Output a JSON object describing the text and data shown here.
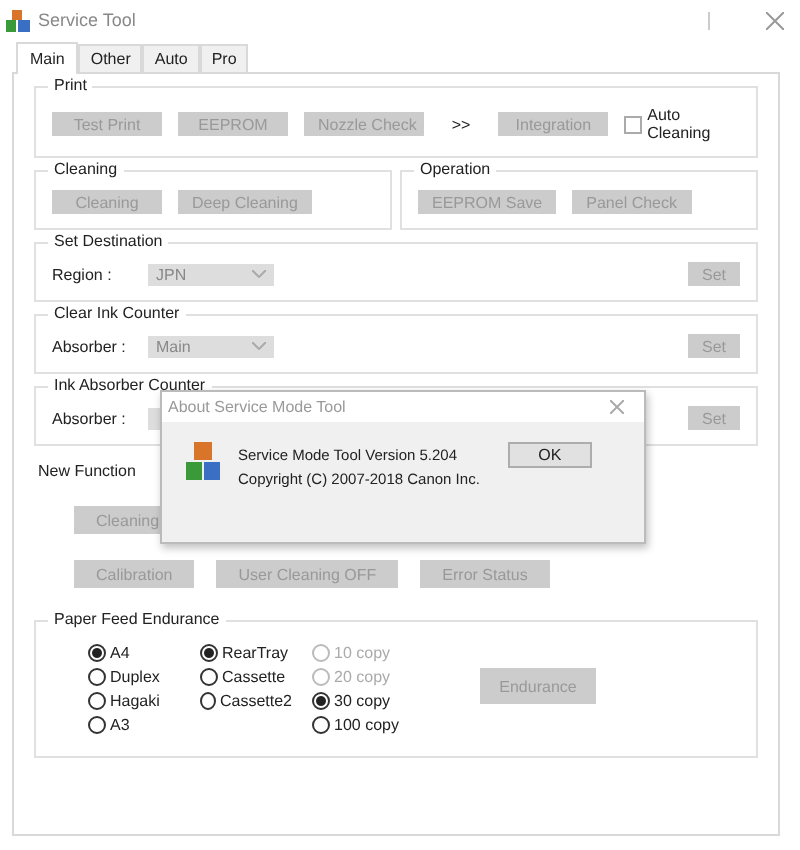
{
  "window": {
    "title": "Service Tool"
  },
  "tabs": [
    {
      "label": "Main",
      "selected": true
    },
    {
      "label": "Other",
      "selected": false
    },
    {
      "label": "Auto",
      "selected": false
    },
    {
      "label": "Pro",
      "selected": false
    }
  ],
  "print": {
    "title": "Print",
    "buttons": [
      {
        "label": "Test Print",
        "disabled": true
      },
      {
        "label": "EEPROM",
        "disabled": true
      },
      {
        "label": "Nozzle Check",
        "disabled": true
      }
    ],
    "arrow": ">>",
    "integration": {
      "label": "Integration",
      "disabled": true
    },
    "auto_cleaning": {
      "label": "Auto Cleaning",
      "checked": false
    }
  },
  "cleaning": {
    "title": "Cleaning",
    "buttons": [
      {
        "label": "Cleaning",
        "disabled": true
      },
      {
        "label": "Deep Cleaning",
        "disabled": true
      }
    ]
  },
  "operation": {
    "title": "Operation",
    "buttons": [
      {
        "label": "EEPROM Save",
        "disabled": true
      },
      {
        "label": "Panel Check",
        "disabled": true
      }
    ]
  },
  "settings": [
    {
      "title": "Set Destination",
      "label": "Region :",
      "value": "JPN",
      "button": {
        "label": "Set",
        "disabled": true
      }
    },
    {
      "title": "Clear Ink Counter",
      "label": "Absorber :",
      "value": "Main",
      "button": {
        "label": "Set",
        "disabled": true
      }
    },
    {
      "title": "Ink Absorber Counter",
      "label": "Absorber :",
      "button": {
        "label": "Set",
        "disabled": true
      }
    }
  ],
  "new_function": {
    "title": "New Function",
    "rows": [
      [
        {
          "label": "Cleaning",
          "disabled": true
        }
      ],
      [
        {
          "label": "Calibration",
          "disabled": true
        },
        {
          "label": "User Cleaning OFF",
          "disabled": true
        },
        {
          "label": "Error Status",
          "disabled": true
        }
      ]
    ]
  },
  "paper_feed": {
    "title": "Paper Feed Endurance",
    "columns": [
      [
        {
          "label": "A4",
          "selected": true,
          "disabled": false
        },
        {
          "label": "Duplex",
          "selected": false,
          "disabled": false
        },
        {
          "label": "Hagaki",
          "selected": false,
          "disabled": false
        },
        {
          "label": "A3",
          "selected": false,
          "disabled": false
        }
      ],
      [
        {
          "label": "RearTray",
          "selected": true,
          "disabled": false
        },
        {
          "label": "Cassette",
          "selected": false,
          "disabled": false
        },
        {
          "label": "Cassette2",
          "selected": false,
          "disabled": false
        }
      ],
      [
        {
          "label": "10 copy",
          "selected": false,
          "disabled": true
        },
        {
          "label": "20 copy",
          "selected": false,
          "disabled": true
        },
        {
          "label": "30 copy",
          "selected": true,
          "disabled": false
        },
        {
          "label": "100 copy",
          "selected": false,
          "disabled": false
        }
      ]
    ],
    "button": {
      "label": "Endurance",
      "disabled": true
    }
  },
  "dialog": {
    "title": "About Service Mode Tool",
    "lines": [
      "Service Mode Tool  Version 5.204",
      "Copyright (C) 2007-2018 Canon Inc."
    ],
    "button": {
      "label": "OK",
      "disabled": false
    }
  }
}
